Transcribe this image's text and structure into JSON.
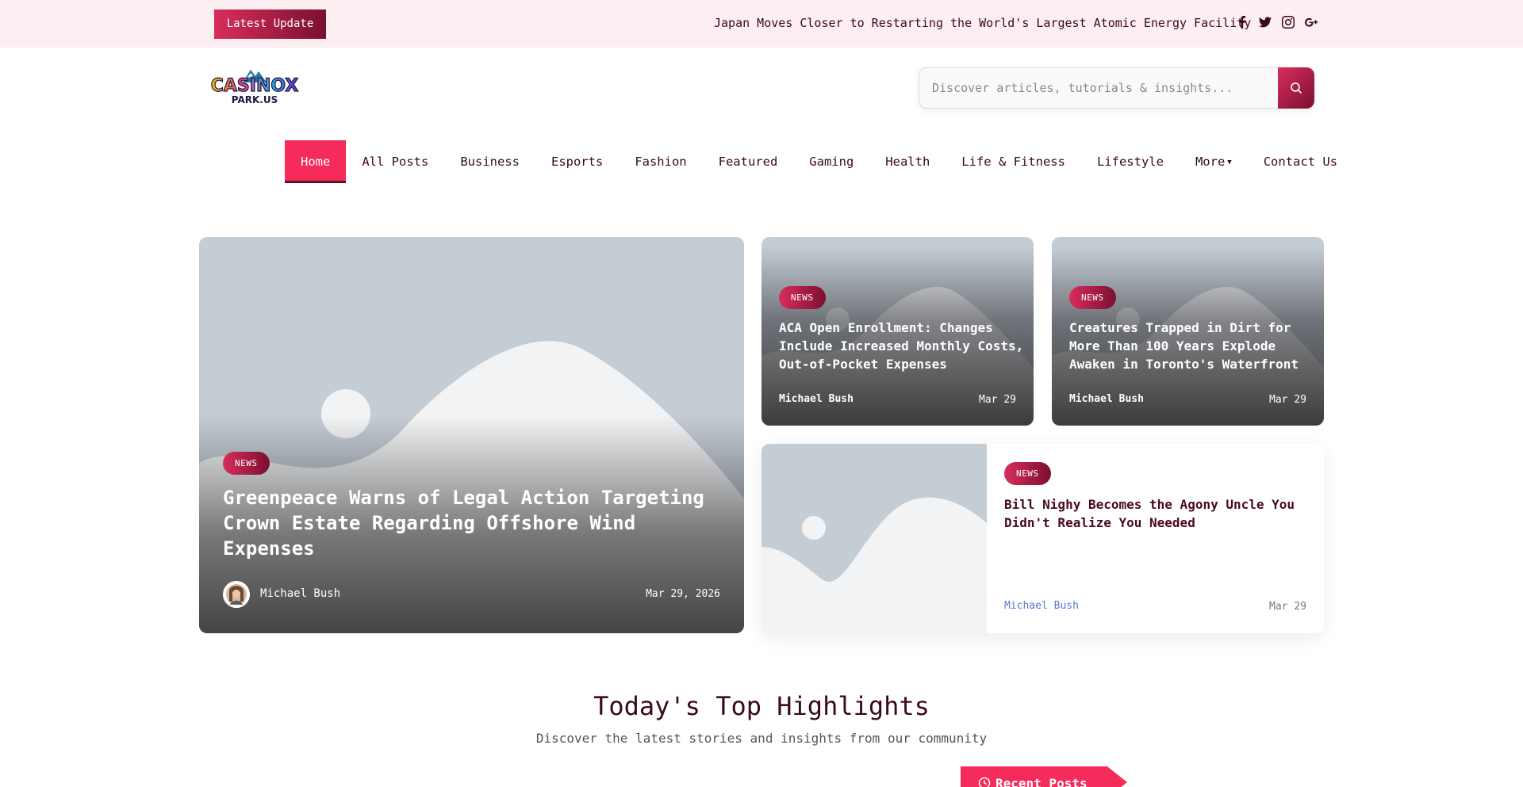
{
  "topbar": {
    "latest_label": "Latest Update",
    "ticker_text": "Japan Moves Closer to Restarting the World's Largest Atomic Energy Facility",
    "social_icons": [
      "facebook-icon",
      "twitter-icon",
      "instagram-icon",
      "google-plus-icon"
    ]
  },
  "header": {
    "logo_text_top": "CASINOX",
    "logo_text_bottom": "PARK.US",
    "search_placeholder": "Discover articles, tutorials & insights..."
  },
  "nav": {
    "items": [
      "Home",
      "All Posts",
      "Business",
      "Esports",
      "Fashion",
      "Featured",
      "Gaming",
      "Health",
      "Life & Fitness",
      "Lifestyle",
      "More",
      "Contact Us"
    ],
    "active": "Home"
  },
  "cards": {
    "hero": {
      "badge": "NEWS",
      "title": "Greenpeace Warns of Legal Action Targeting Crown Estate Regarding Offshore Wind Expenses",
      "author": "Michael Bush",
      "date": "Mar 29, 2026"
    },
    "small1": {
      "badge": "NEWS",
      "title": "ACA Open Enrollment: Changes Include Increased Monthly Costs, Out-of-Pocket Expenses",
      "author": "Michael Bush",
      "date": "Mar 29"
    },
    "small2": {
      "badge": "NEWS",
      "title": "Creatures Trapped in Dirt for More Than 100 Years Explode Awaken in Toronto's Waterfront",
      "author": "Michael Bush",
      "date": "Mar 29"
    },
    "wide": {
      "badge": "NEWS",
      "title": "Bill Nighy Becomes the Agony Uncle You Didn't Realize You Needed",
      "author": "Michael Bush",
      "date": "Mar 29"
    }
  },
  "section": {
    "title": "Today's Top Highlights",
    "subtitle": "Discover the latest stories and insights from our community",
    "tab_label": "Recent Posts"
  },
  "colors": {
    "accent": "#f52b5c",
    "accent_dark": "#7a1030",
    "topbar_bg": "#fdeef2",
    "text_dark": "#3a0a1a",
    "author_link": "#5a7ad0"
  }
}
